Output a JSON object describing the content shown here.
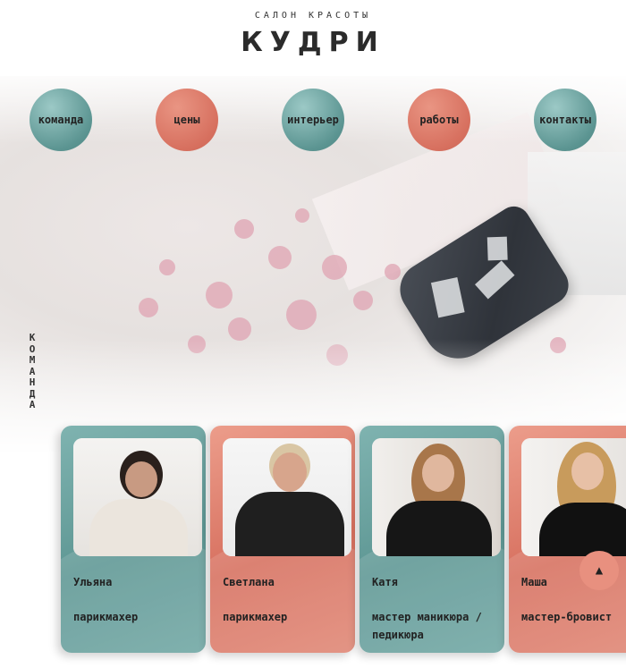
{
  "brand": {
    "subtitle": "САЛОН КРАСОТЫ",
    "logo": "КУДРИ"
  },
  "nav": [
    {
      "label": "команда",
      "style": "teal"
    },
    {
      "label": "цены",
      "style": "coral"
    },
    {
      "label": "интерьер",
      "style": "teal"
    },
    {
      "label": "работы",
      "style": "coral"
    },
    {
      "label": "контакты",
      "style": "teal"
    }
  ],
  "section": {
    "vertical_label": "КОМАНДА"
  },
  "team": [
    {
      "name": "Ульяна",
      "role": "парикмахер"
    },
    {
      "name": "Светлана",
      "role": "парикмахер"
    },
    {
      "name": "Катя",
      "role": "мастер маникюра / педикюра"
    },
    {
      "name": "Маша",
      "role": "мастер-бровист"
    }
  ],
  "colors": {
    "teal": "#5e9794",
    "coral": "#d7705f",
    "text": "#222222"
  },
  "icons": {
    "scroll_top": "caret-up-icon",
    "logo_scissors": "scissors-icon"
  }
}
